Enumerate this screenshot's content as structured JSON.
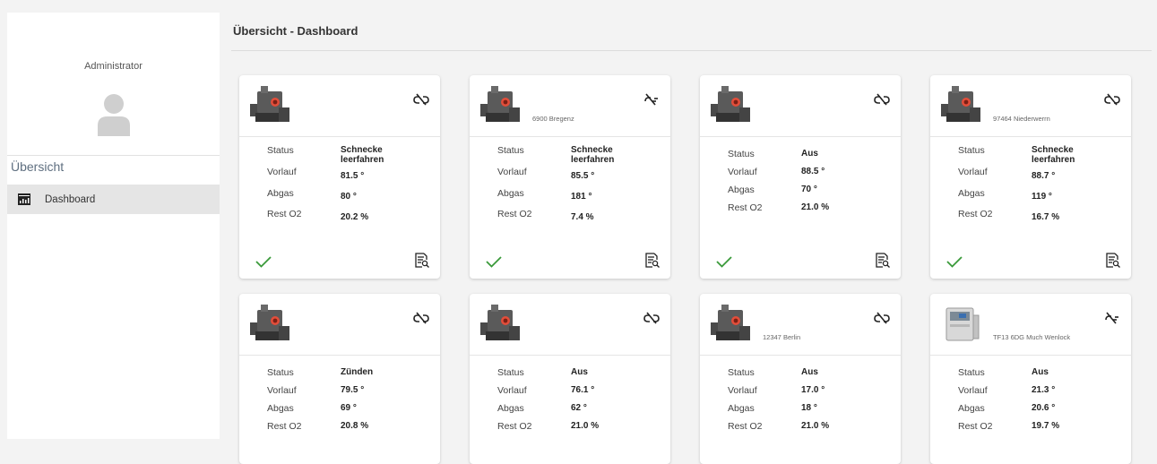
{
  "sidebar": {
    "user": "Administrator",
    "section": "Übersicht",
    "items": [
      {
        "label": "Dashboard",
        "icon": "dashboard-icon"
      }
    ]
  },
  "header": {
    "title": "Übersicht - Dashboard"
  },
  "labels": {
    "status": "Status",
    "vorlauf": "Vorlauf",
    "abgas": "Abgas",
    "rest_o2": "Rest O2"
  },
  "colors": {
    "ok": "#3a9a3a",
    "boiler_body": "#5a5a5a",
    "boiler_accent": "#e24d3a"
  },
  "cards": [
    {
      "location": "",
      "link": "link-broken-icon",
      "device": "dark",
      "status": [
        "Schnecke",
        "leerfahren"
      ],
      "vorlauf": "81.5 °",
      "abgas": "80 °",
      "rest_o2": "20.2 %"
    },
    {
      "location": "6900 Bregenz",
      "link": "link-off-icon",
      "device": "dark",
      "status": [
        "Schnecke",
        "leerfahren"
      ],
      "vorlauf": "85.5 °",
      "abgas": "181 °",
      "rest_o2": "7.4 %"
    },
    {
      "location": "",
      "link": "link-broken-icon",
      "device": "dark",
      "status": [
        "Aus",
        ""
      ],
      "vorlauf": "88.5 °",
      "abgas": "70 °",
      "rest_o2": "21.0 %"
    },
    {
      "location": "97464 Niederwerrn",
      "link": "link-broken-icon",
      "device": "dark",
      "status": [
        "Schnecke",
        "leerfahren"
      ],
      "vorlauf": "88.7 °",
      "abgas": "119 °",
      "rest_o2": "16.7 %"
    },
    {
      "location": "",
      "link": "link-broken-icon",
      "device": "dark",
      "status": [
        "Zünden",
        ""
      ],
      "vorlauf": "79.5 °",
      "abgas": "69 °",
      "rest_o2": "20.8 %"
    },
    {
      "location": "",
      "link": "link-broken-icon",
      "device": "dark",
      "status": [
        "Aus",
        ""
      ],
      "vorlauf": "76.1 °",
      "abgas": "62 °",
      "rest_o2": "21.0 %"
    },
    {
      "location": "12347 Berlin",
      "link": "link-broken-icon",
      "device": "dark",
      "status": [
        "Aus",
        ""
      ],
      "vorlauf": "17.0 °",
      "abgas": "18 °",
      "rest_o2": "21.0 %"
    },
    {
      "location": "TF13 6DG Much Wenlock",
      "link": "link-off-icon",
      "device": "light",
      "status": [
        "Aus",
        ""
      ],
      "vorlauf": "21.3 °",
      "abgas": "20.6 °",
      "rest_o2": "19.7 %"
    }
  ]
}
